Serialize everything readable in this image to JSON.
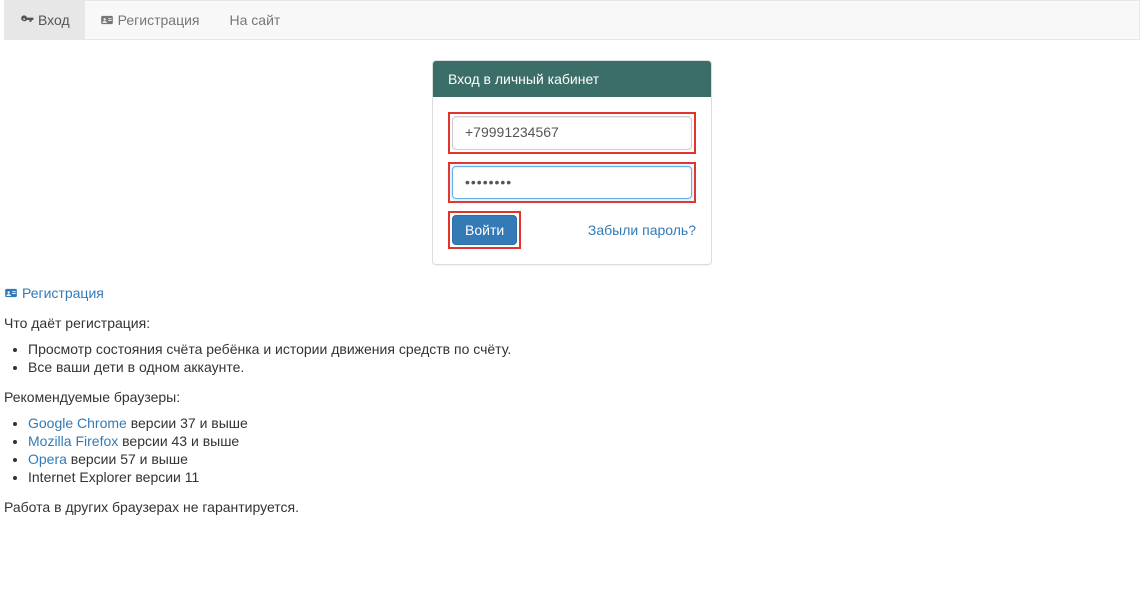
{
  "nav": {
    "login": "Вход",
    "register": "Регистрация",
    "site": "На сайт"
  },
  "panel": {
    "heading": "Вход в личный кабинет",
    "phone_value": "+79991234567",
    "password_value": "••••••••",
    "submit": "Войти",
    "forgot": "Забыли пароль?"
  },
  "registration": {
    "link": "Регистрация",
    "heading": "Что даёт регистрация:",
    "benefits": [
      "Просмотр состояния счёта ребёнка и истории движения средств по счёту.",
      "Все ваши дети в одном аккаунте."
    ]
  },
  "browsers": {
    "heading": "Рекомендуемые браузеры:",
    "items": [
      {
        "name": "Google Chrome",
        "suffix": " версии 37 и выше",
        "link": true
      },
      {
        "name": "Mozilla Firefox",
        "suffix": " версии 43 и выше",
        "link": true
      },
      {
        "name": "Opera",
        "suffix": " версии 57 и выше",
        "link": true
      },
      {
        "name": "Internet Explorer версии 11",
        "suffix": "",
        "link": false
      }
    ],
    "footer": "Работа в других браузерах не гарантируется."
  }
}
